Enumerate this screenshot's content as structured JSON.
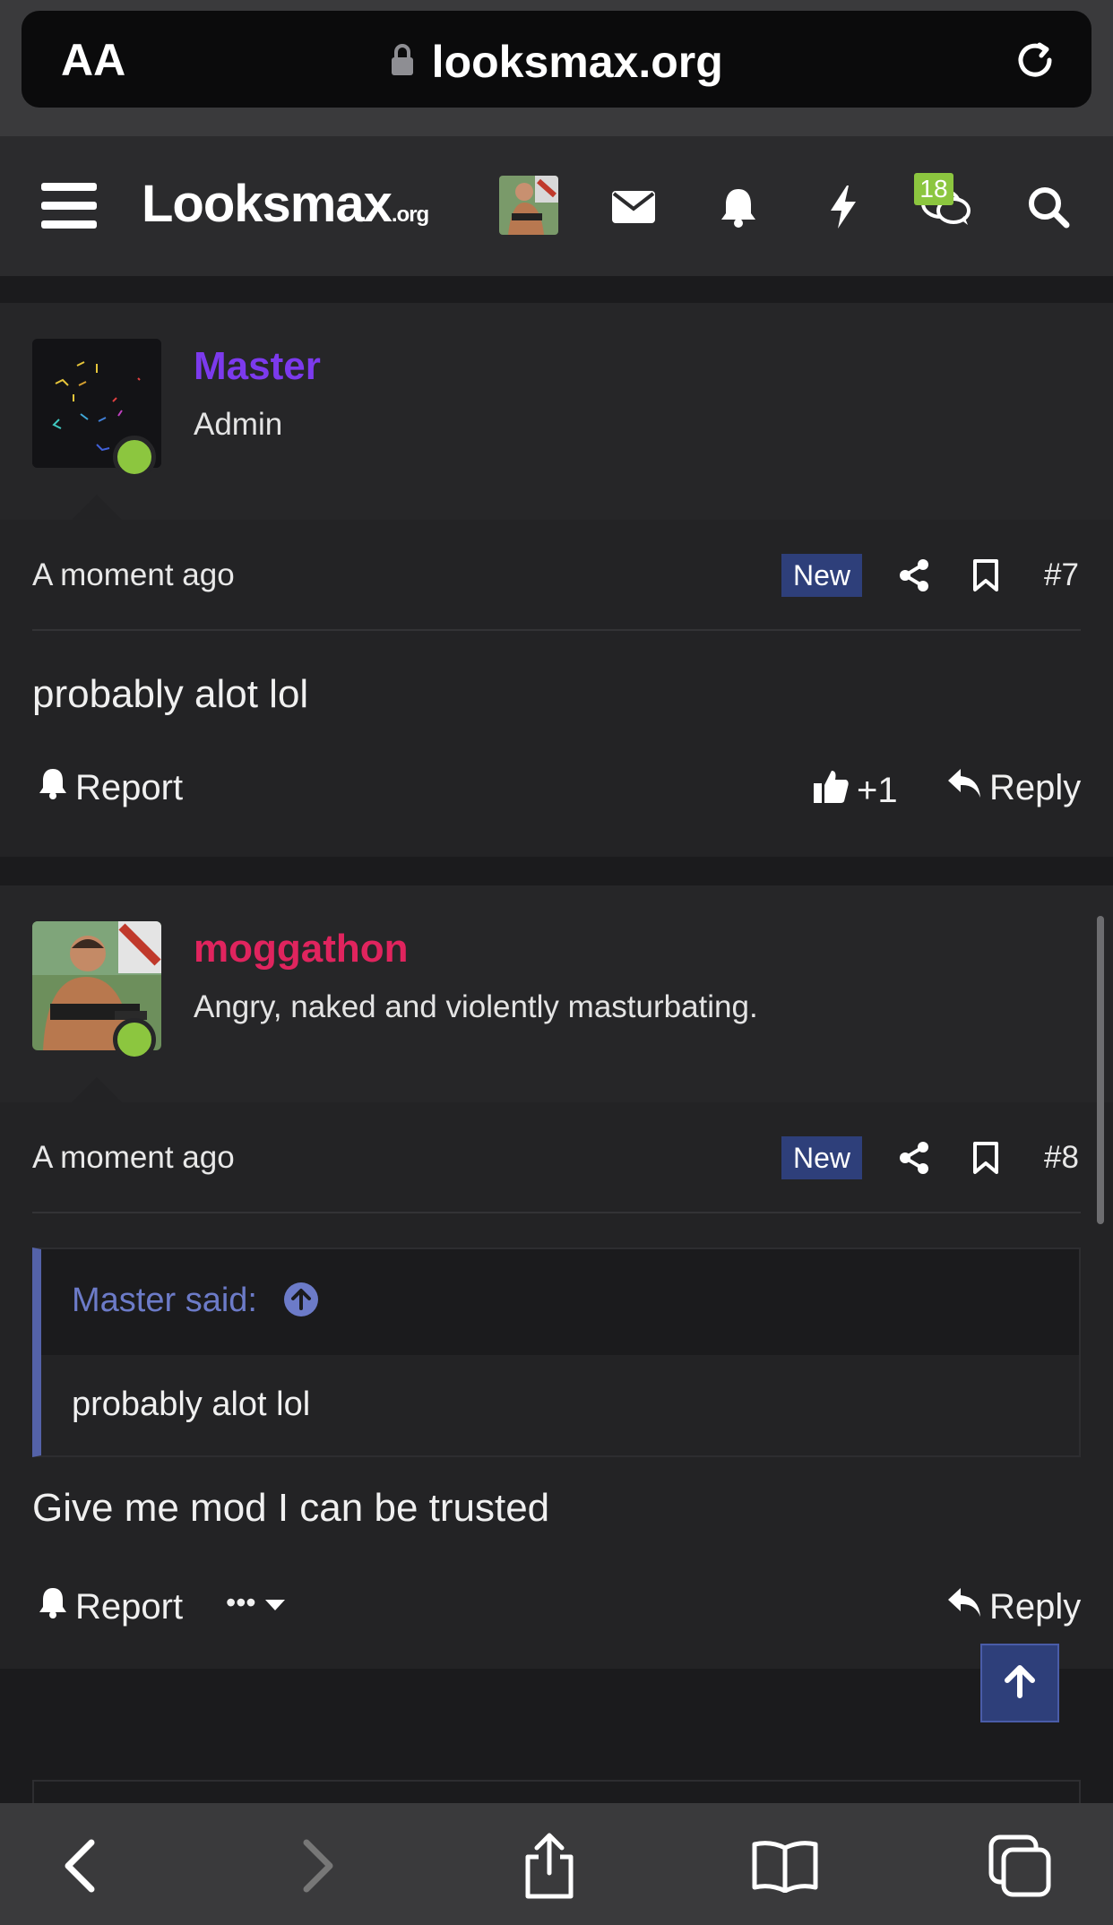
{
  "browser": {
    "text_size_label": "AA",
    "url": "looksmax.org"
  },
  "site": {
    "logo_text": "Looksmax",
    "logo_suffix": ".org",
    "conversations_count": "18"
  },
  "posts": [
    {
      "username": "Master",
      "username_color": "#7c3aed",
      "user_title": "Admin",
      "time": "A moment ago",
      "new_label": "New",
      "post_number": "#7",
      "body": "probably alot lol",
      "report_label": "Report",
      "like_count": "+1",
      "reply_label": "Reply"
    },
    {
      "username": "moggathon",
      "username_color": "#e0245e",
      "user_title": "Angry, naked and violently masturbating.",
      "time": "A moment ago",
      "new_label": "New",
      "post_number": "#8",
      "quote_author": "Master said:",
      "quote_text": "probably alot lol",
      "body": "Give me mod I can be trusted",
      "report_label": "Report",
      "more_label": "•••",
      "reply_label": "Reply"
    }
  ],
  "colors": {
    "online": "#8cc63f",
    "new_badge": "#2e3f7a",
    "quote_accent": "#5462a8"
  }
}
